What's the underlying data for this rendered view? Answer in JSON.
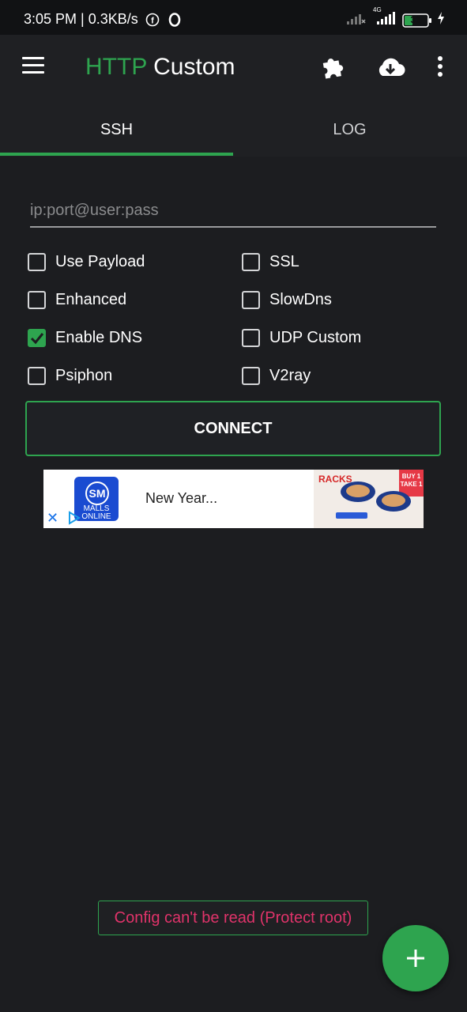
{
  "status_bar": {
    "time_network": "3:05 PM | 0.3KB/s",
    "network_type": "4G",
    "battery": "31"
  },
  "app_bar": {
    "title_part1": "HTTP",
    "title_part2": "Custom",
    "icons": [
      "menu-icon",
      "puzzle-icon",
      "cloud-download-icon",
      "more-vert-icon"
    ]
  },
  "tabs": [
    {
      "label": "SSH",
      "active": true
    },
    {
      "label": "LOG",
      "active": false
    }
  ],
  "host_input": {
    "placeholder": "ip:port@user:pass",
    "value": ""
  },
  "options": {
    "use_payload": {
      "label": "Use Payload",
      "checked": false
    },
    "ssl": {
      "label": "SSL",
      "checked": false
    },
    "enhanced": {
      "label": "Enhanced",
      "checked": false
    },
    "slowdns": {
      "label": "SlowDns",
      "checked": false
    },
    "enable_dns": {
      "label": "Enable DNS",
      "checked": true
    },
    "udp_custom": {
      "label": "UDP Custom",
      "checked": false
    },
    "psiphon": {
      "label": "Psiphon",
      "checked": false
    },
    "v2ray": {
      "label": "V2ray",
      "checked": false
    }
  },
  "connect_label": "CONNECT",
  "ad": {
    "logo_text": "SM",
    "logo_subtext": "MALLS ONLINE",
    "headline": "New Year...",
    "brand_text": "RACKS",
    "promo_text": "BUY 1 TAKE 1"
  },
  "toast": "Config can't be read (Protect root)",
  "colors": {
    "accent": "#2ea44f",
    "background": "#1c1d20",
    "toast_text": "#e0336a"
  }
}
